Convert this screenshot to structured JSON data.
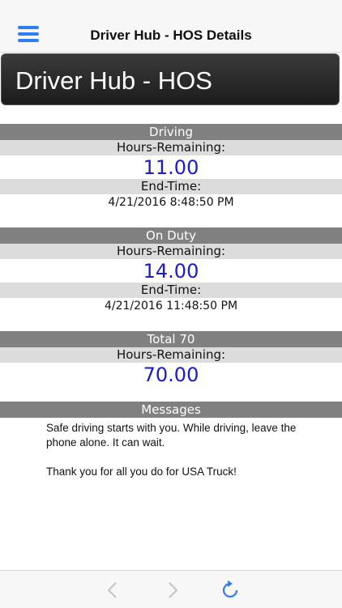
{
  "navbar": {
    "title": "Driver Hub - HOS Details",
    "menu_icon": "hamburger-menu-icon"
  },
  "banner": {
    "title": "Driver Hub - HOS"
  },
  "sections": [
    {
      "title": "Driving",
      "hours_label": "Hours-Remaining:",
      "hours_value": "11.00",
      "end_label": "End-Time:",
      "end_value": "4/21/2016 8:48:50 PM"
    },
    {
      "title": "On Duty",
      "hours_label": "Hours-Remaining:",
      "hours_value": "14.00",
      "end_label": "End-Time:",
      "end_value": "4/21/2016 11:48:50 PM"
    },
    {
      "title": "Total 70",
      "hours_label": "Hours-Remaining:",
      "hours_value": "70.00"
    }
  ],
  "messages": {
    "title": "Messages",
    "lines": [
      "Safe driving starts with you. While driving, leave the phone alone. It can wait.",
      "Thank you for all you do for USA Truck!"
    ]
  },
  "toolbar": {
    "back_icon": "chevron-left-icon",
    "forward_icon": "chevron-right-icon",
    "refresh_icon": "refresh-icon"
  },
  "colors": {
    "accent": "#2f7cf6",
    "value_blue": "#1a1ad0",
    "section_header": "#808080",
    "sub_header": "#dcdcdc"
  }
}
